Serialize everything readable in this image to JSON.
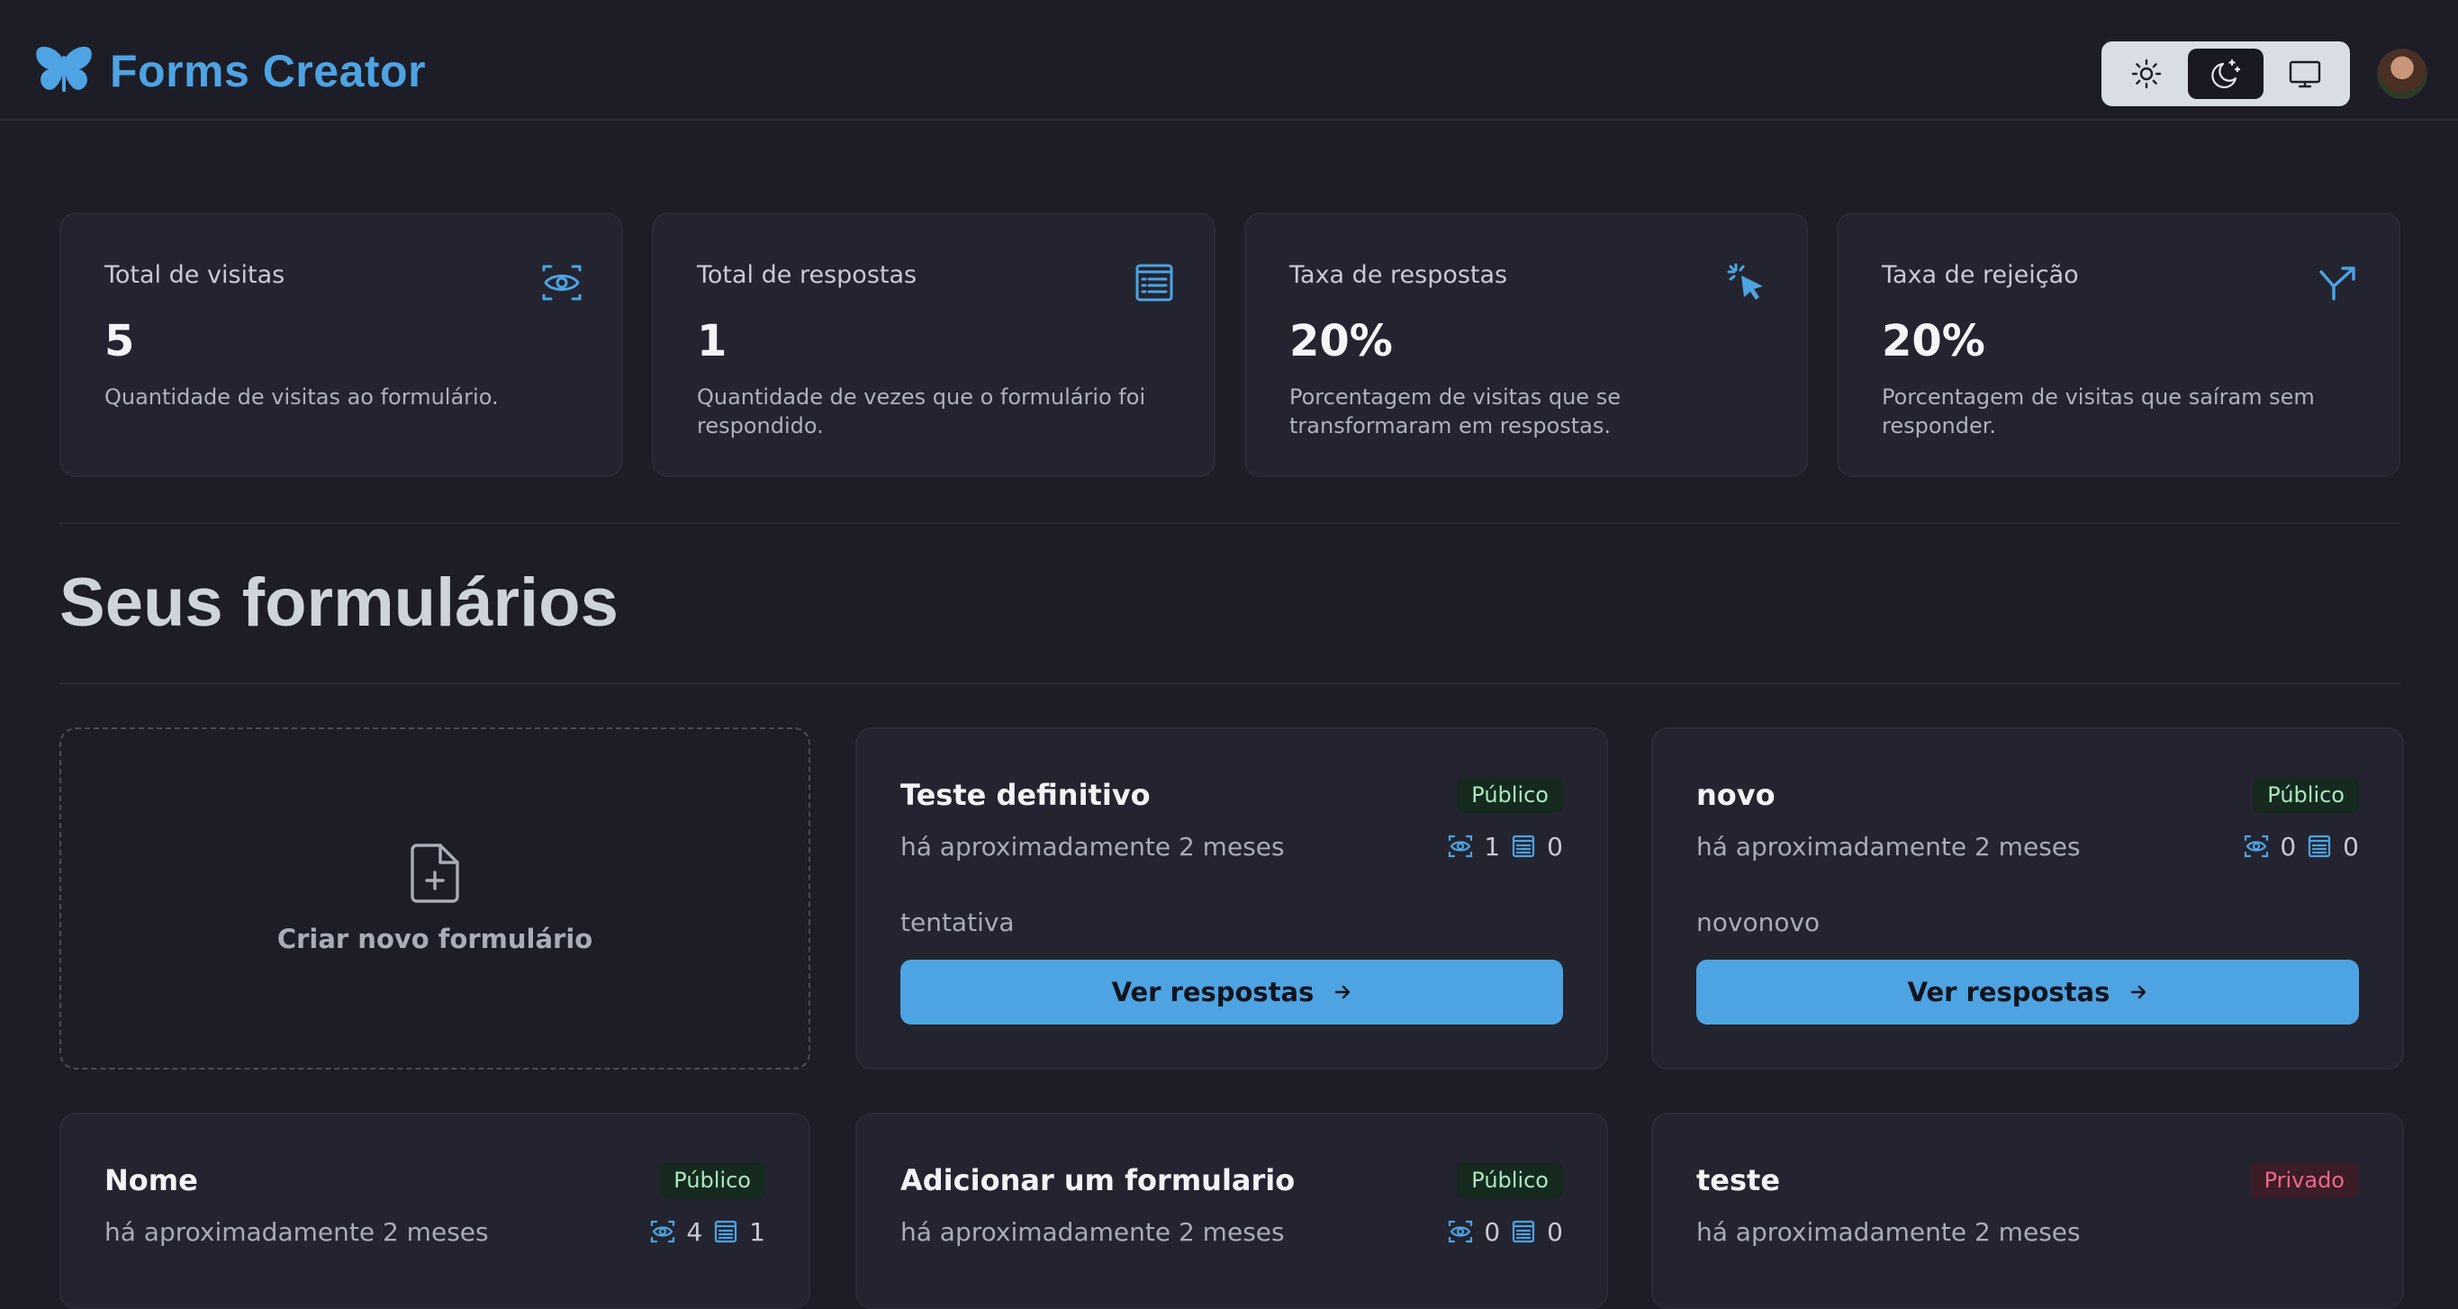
{
  "header": {
    "app_title": "Forms Creator",
    "theme_options": [
      "light",
      "dark",
      "system"
    ],
    "active_theme": "dark"
  },
  "stats": [
    {
      "title": "Total de visitas",
      "value": "5",
      "description": "Quantidade de visitas ao formulário.",
      "icon": "eye-icon"
    },
    {
      "title": "Total de respostas",
      "value": "1",
      "description": "Quantidade de vezes que o formulário foi respondido.",
      "icon": "form-list-icon"
    },
    {
      "title": "Taxa de respostas",
      "value": "20%",
      "description": "Porcentagem de visitas que se transformaram em respostas.",
      "icon": "cursor-click-icon"
    },
    {
      "title": "Taxa de rejeição",
      "value": "20%",
      "description": "Porcentagem de visitas que saíram sem responder.",
      "icon": "split-arrow-icon"
    }
  ],
  "section_title": "Seus formulários",
  "new_form": {
    "label": "Criar novo formulário"
  },
  "forms": [
    {
      "name": "Teste definitivo",
      "status": "Público",
      "date": "há aproximadamente 2 meses",
      "visits": "1",
      "responses": "0",
      "description": "tentativa",
      "button_label": "Ver respostas"
    },
    {
      "name": "novo",
      "status": "Público",
      "date": "há aproximadamente 2 meses",
      "visits": "0",
      "responses": "0",
      "description": "novonovo",
      "button_label": "Ver respostas"
    },
    {
      "name": "Nome",
      "status": "Público",
      "date": "há aproximadamente 2 meses",
      "visits": "4",
      "responses": "1"
    },
    {
      "name": "Adicionar um formulario",
      "status": "Público",
      "date": "há aproximadamente 2 meses",
      "visits": "0",
      "responses": "0"
    },
    {
      "name": "teste",
      "status": "Privado",
      "date": "há aproximadamente 2 meses"
    }
  ],
  "colors": {
    "accent": "#4ea3e2",
    "background": "#1c1d27",
    "card": "#232430",
    "public_badge": "#a9e8c0",
    "private_badge": "#f0658a"
  }
}
